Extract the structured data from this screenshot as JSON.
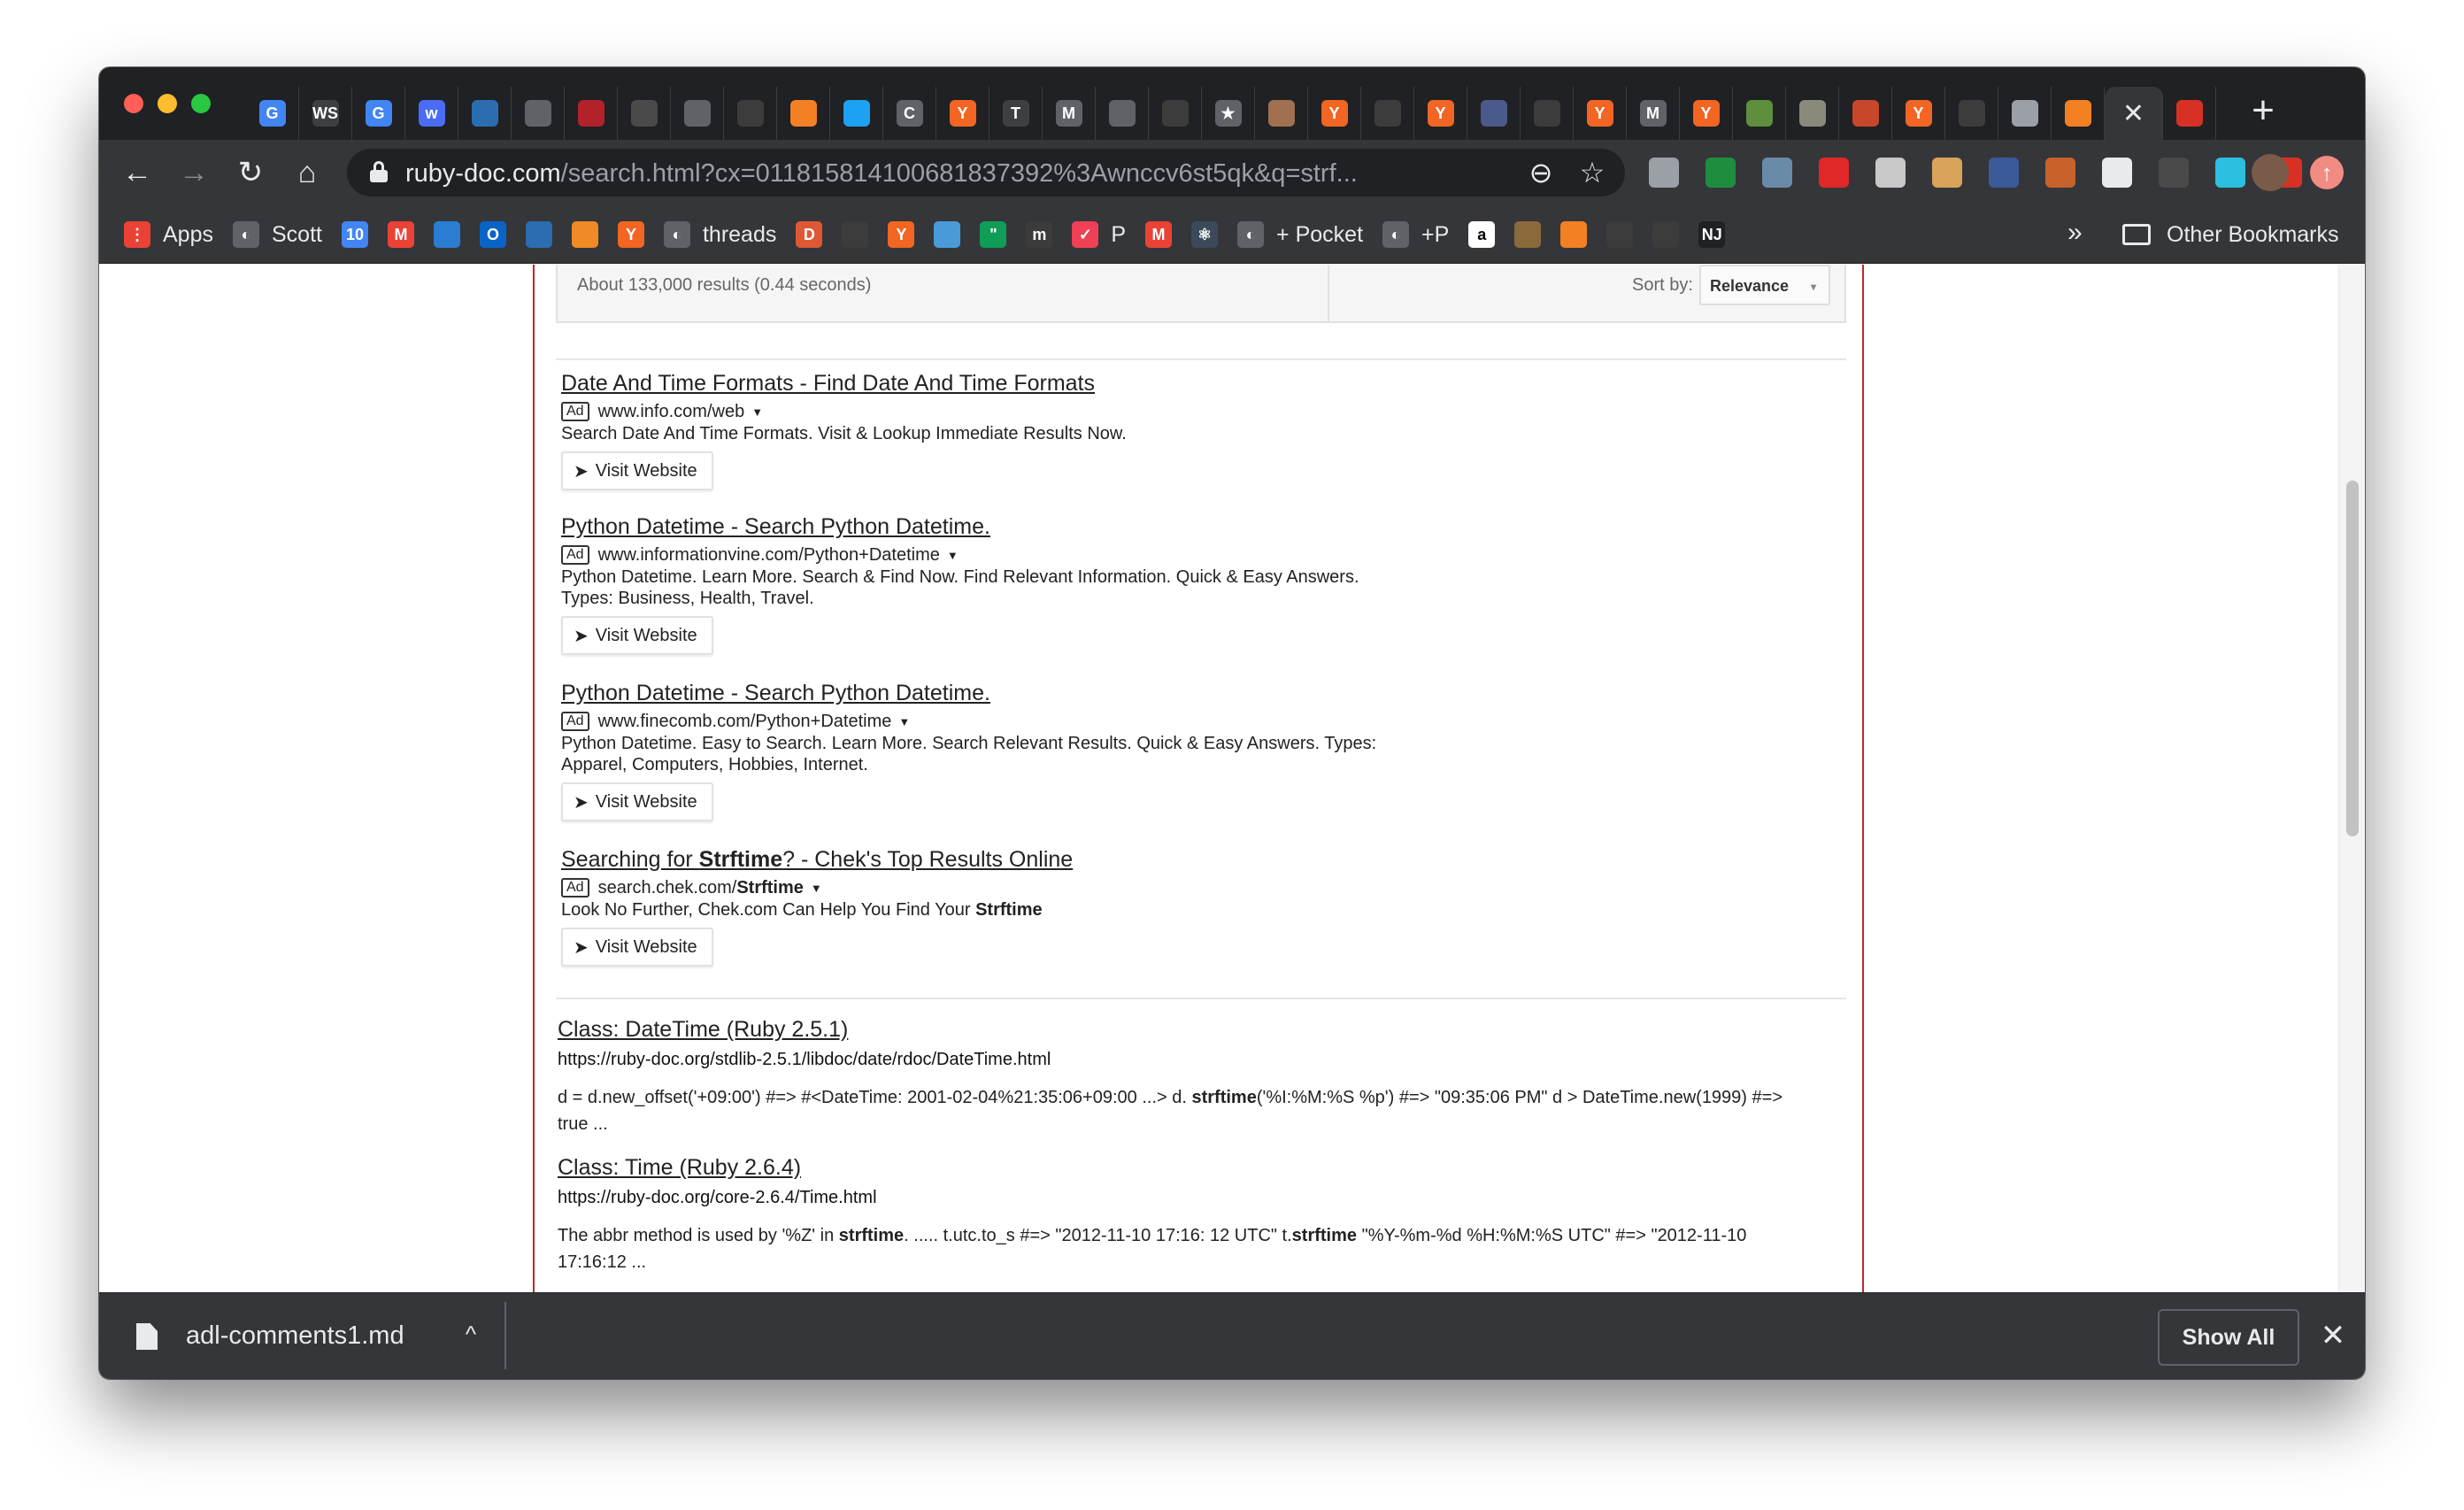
{
  "tabstrip": {
    "tabs": [
      {
        "icon": "google-icon",
        "glyph": "G",
        "color": "#4285f4"
      },
      {
        "icon": "ws-icon",
        "glyph": "WS",
        "color": "#3c4043"
      },
      {
        "icon": "google-icon",
        "glyph": "G",
        "color": "#4285f4"
      },
      {
        "icon": "w-icon",
        "glyph": "w",
        "color": "#4a6cf7"
      },
      {
        "icon": "box-icon",
        "glyph": "",
        "color": "#2a6db0"
      },
      {
        "icon": "planet-icon",
        "glyph": "",
        "color": "#5f6368"
      },
      {
        "icon": "ruby-icon",
        "glyph": "",
        "color": "#b3212a"
      },
      {
        "icon": "grid-icon",
        "glyph": "",
        "color": "#4a4a4a"
      },
      {
        "icon": "globe-icon",
        "glyph": "",
        "color": "#5f6368"
      },
      {
        "icon": "bird-icon",
        "glyph": "",
        "color": "#3c3c3c"
      },
      {
        "icon": "stackoverflow-icon",
        "glyph": "",
        "color": "#f48024"
      },
      {
        "icon": "twitter-icon",
        "glyph": "",
        "color": "#1da1f2"
      },
      {
        "icon": "loading-icon",
        "glyph": "C",
        "color": "#5f6368"
      },
      {
        "icon": "hn-icon",
        "glyph": "Y",
        "color": "#f26522"
      },
      {
        "icon": "nyt-icon",
        "glyph": "T",
        "color": "#3c4043"
      },
      {
        "icon": "gmail-icon",
        "glyph": "M",
        "color": "#5f6368"
      },
      {
        "icon": "globe-icon",
        "glyph": "",
        "color": "#5f6368"
      },
      {
        "icon": "github-icon",
        "glyph": "",
        "color": "#3c3c3c"
      },
      {
        "icon": "star-icon",
        "glyph": "★",
        "color": "#5f6368"
      },
      {
        "icon": "photo-icon",
        "glyph": "",
        "color": "#a07050"
      },
      {
        "icon": "hn-icon",
        "glyph": "Y",
        "color": "#f26522"
      },
      {
        "icon": "github-icon",
        "glyph": "",
        "color": "#3c3c3c"
      },
      {
        "icon": "hn-icon",
        "glyph": "Y",
        "color": "#f26522"
      },
      {
        "icon": "planet-icon",
        "glyph": "",
        "color": "#4a5a8a"
      },
      {
        "icon": "tools-icon",
        "glyph": "",
        "color": "#3c3c3c"
      },
      {
        "icon": "hn-icon",
        "glyph": "Y",
        "color": "#f26522"
      },
      {
        "icon": "gmail-icon",
        "glyph": "M",
        "color": "#5f6368"
      },
      {
        "icon": "hn-icon",
        "glyph": "Y",
        "color": "#f26522"
      },
      {
        "icon": "shopify-icon",
        "glyph": "",
        "color": "#5e8e3e"
      },
      {
        "icon": "map-icon",
        "glyph": "",
        "color": "#8a8a7a"
      },
      {
        "icon": "circle-icon",
        "glyph": "",
        "color": "#c8462a"
      },
      {
        "icon": "hn-icon",
        "glyph": "Y",
        "color": "#f26522"
      },
      {
        "icon": "github-icon",
        "glyph": "",
        "color": "#3c3c3c"
      },
      {
        "icon": "hexagon-icon",
        "glyph": "",
        "color": "#9aa0a6"
      },
      {
        "icon": "stackoverflow-icon",
        "glyph": "",
        "color": "#f48024"
      },
      {
        "icon": "close-icon",
        "glyph": "✕",
        "color": "#35363a",
        "active": true
      },
      {
        "icon": "red-box-icon",
        "glyph": "",
        "color": "#d93025"
      }
    ],
    "newtab_glyph": "+"
  },
  "toolbar": {
    "back_glyph": "←",
    "forward_glyph": "→",
    "reload_glyph": "↻",
    "home_glyph": "⌂",
    "url_host": "ruby-doc.com",
    "url_rest": "/search.html?cx=011815814100681837392%3Awnccv6st5qk&q=strf...",
    "zoom_glyph": "⊖",
    "star_glyph": "☆",
    "extensions": [
      {
        "icon": "cast-icon",
        "color": "#9aa0a6"
      },
      {
        "icon": "green-dot-icon",
        "color": "#1e8e3e"
      },
      {
        "icon": "eyedropper-icon",
        "color": "#6a8aaa"
      },
      {
        "icon": "flipboard-icon",
        "color": "#e12828"
      },
      {
        "icon": "mmra-icon",
        "color": "#c8c8c8"
      },
      {
        "icon": "robot-icon",
        "color": "#d9a35a"
      },
      {
        "icon": "ssl-icon",
        "color": "#3a5a9a"
      },
      {
        "icon": "nj-icon",
        "color": "#c8622a"
      },
      {
        "icon": "octopus-icon",
        "color": "#e8eaed"
      },
      {
        "icon": "q-icon",
        "color": "#4a4a4a"
      },
      {
        "icon": "map-ext-icon",
        "color": "#2bbfe0"
      },
      {
        "icon": "stop-hand-icon",
        "color": "#d93025"
      }
    ],
    "update_glyph": "↑"
  },
  "bookmarks": {
    "items": [
      {
        "label": "Apps",
        "icon": "apps-grid-icon",
        "color": "#ea4335",
        "glyph": "⋮"
      },
      {
        "label": "Scott",
        "icon": "globe-icon",
        "color": "#5f6368",
        "glyph": "◐"
      },
      {
        "label": "",
        "icon": "calendar-icon",
        "color": "#4285f4",
        "glyph": "10"
      },
      {
        "label": "",
        "icon": "gmail-icon",
        "color": "#ea4335",
        "glyph": "M"
      },
      {
        "label": "",
        "icon": "doc-icon",
        "color": "#2b7cd3",
        "glyph": ""
      },
      {
        "label": "",
        "icon": "outlook-icon",
        "color": "#0a64c8",
        "glyph": "O"
      },
      {
        "label": "",
        "icon": "phone-icon",
        "color": "#2a6db0",
        "glyph": ""
      },
      {
        "label": "",
        "icon": "cube-icon",
        "color": "#f08a24",
        "glyph": ""
      },
      {
        "label": "",
        "icon": "hn-icon",
        "color": "#f26522",
        "glyph": "Y"
      },
      {
        "label": "threads",
        "icon": "globe-icon",
        "color": "#5f6368",
        "glyph": "◐"
      },
      {
        "label": "",
        "icon": "duckduckgo-icon",
        "color": "#de5833",
        "glyph": "D"
      },
      {
        "label": "",
        "icon": "robot-icon",
        "color": "#3c3c3c",
        "glyph": ""
      },
      {
        "label": "",
        "icon": "hn-icon",
        "color": "#f26522",
        "glyph": "Y"
      },
      {
        "label": "",
        "icon": "diamond-icon",
        "color": "#4a9ad8",
        "glyph": ""
      },
      {
        "label": "",
        "icon": "hangouts-icon",
        "color": "#0f9d58",
        "glyph": "\""
      },
      {
        "label": "",
        "icon": "m-icon",
        "color": "#3c3c3c",
        "glyph": "m"
      },
      {
        "label": "P",
        "icon": "pocket-icon",
        "color": "#ef4056",
        "glyph": "✓"
      },
      {
        "label": "",
        "icon": "gmail-icon",
        "color": "#ea4335",
        "glyph": "M"
      },
      {
        "label": "",
        "icon": "react-icon",
        "color": "#3a4a5a",
        "glyph": "⚛"
      },
      {
        "label": "+ Pocket",
        "icon": "globe-icon",
        "color": "#5f6368",
        "glyph": "◐"
      },
      {
        "label": "+P",
        "icon": "globe-icon",
        "color": "#5f6368",
        "glyph": "◐"
      },
      {
        "label": "",
        "icon": "amazon-icon",
        "color": "#ffffff",
        "glyph": "a"
      },
      {
        "label": "",
        "icon": "book-icon",
        "color": "#8a6a3a",
        "glyph": ""
      },
      {
        "label": "",
        "icon": "stackoverflow-icon",
        "color": "#f48024",
        "glyph": ""
      },
      {
        "label": "",
        "icon": "github-icon",
        "color": "#3c3c3c",
        "glyph": ""
      },
      {
        "label": "",
        "icon": "github-icon",
        "color": "#3c3c3c",
        "glyph": ""
      },
      {
        "label": "",
        "icon": "nj-icon",
        "color": "#202124",
        "glyph": "NJ"
      }
    ],
    "more_glyph": "»",
    "other_label": "Other Bookmarks"
  },
  "results": {
    "count_text": "About 133,000 results (0.44 seconds)",
    "sort_label": "Sort by:",
    "sort_value": "Relevance",
    "sort_caret": "▾"
  },
  "ads": [
    {
      "title": "Date And Time Formats - Find Date And Time Formats",
      "badge": "Ad",
      "url": "www.info.com/web",
      "desc": [
        "Search Date And Time Formats. Visit & Lookup Immediate Results Now."
      ],
      "button": "Visit Website"
    },
    {
      "title": "Python Datetime - Search Python Datetime.",
      "badge": "Ad",
      "url": "www.informationvine.com/Python+Datetime",
      "desc": [
        "Python Datetime. Learn More. Search & Find Now. Find Relevant Information. Quick & Easy Answers.",
        "Types: Business, Health, Travel."
      ],
      "button": "Visit Website"
    },
    {
      "title": "Python Datetime - Search Python Datetime.",
      "badge": "Ad",
      "url": "www.finecomb.com/Python+Datetime",
      "desc": [
        "Python Datetime. Easy to Search. Learn More. Search Relevant Results. Quick & Easy Answers. Types:",
        "Apparel, Computers, Hobbies, Internet."
      ],
      "button": "Visit Website"
    },
    {
      "title_pre": "Searching for ",
      "title_bold": "Strftime",
      "title_post": "? - Chek's Top Results Online",
      "badge": "Ad",
      "url_pre": "search.chek.com/",
      "url_bold": "Strftime",
      "desc_pre": "Look No Further, Chek.com Can Help You Find Your ",
      "desc_bold": "Strftime",
      "button": "Visit Website"
    }
  ],
  "organic": [
    {
      "title": "Class: DateTime (Ruby 2.5.1)",
      "url": "https://ruby-doc.org/stdlib-2.5.1/libdoc/date/rdoc/DateTime.html",
      "snip_a": "d = d.new_offset('+09:00') #=> #<DateTime: 2001-02-04%21:35:06+09:00 ...> d. ",
      "snip_bold": "strftime",
      "snip_b": "('%I:%M:%S %p') #=> \"09:35:06 PM\" d > DateTime.new(1999) #=> true ..."
    },
    {
      "title": "Class: Time (Ruby 2.6.4)",
      "url": "https://ruby-doc.org/core-2.6.4/Time.html",
      "snip_a": "The abbr method is used by '%Z' in ",
      "snip_bold": "strftime",
      "snip_b": ". ..... t.utc.to_s #=> \"2012-11-10 17:16: 12 UTC\" t.",
      "snip_bold2": "strftime",
      "snip_c": " \"%Y-%m-%d %H:%M:%S UTC\" #=> \"2012-11-10 17:16:12 ..."
    }
  ],
  "download_shelf": {
    "filename": "adl-comments1.md",
    "caret_glyph": "^",
    "show_all": "Show All",
    "close_glyph": "✕"
  }
}
